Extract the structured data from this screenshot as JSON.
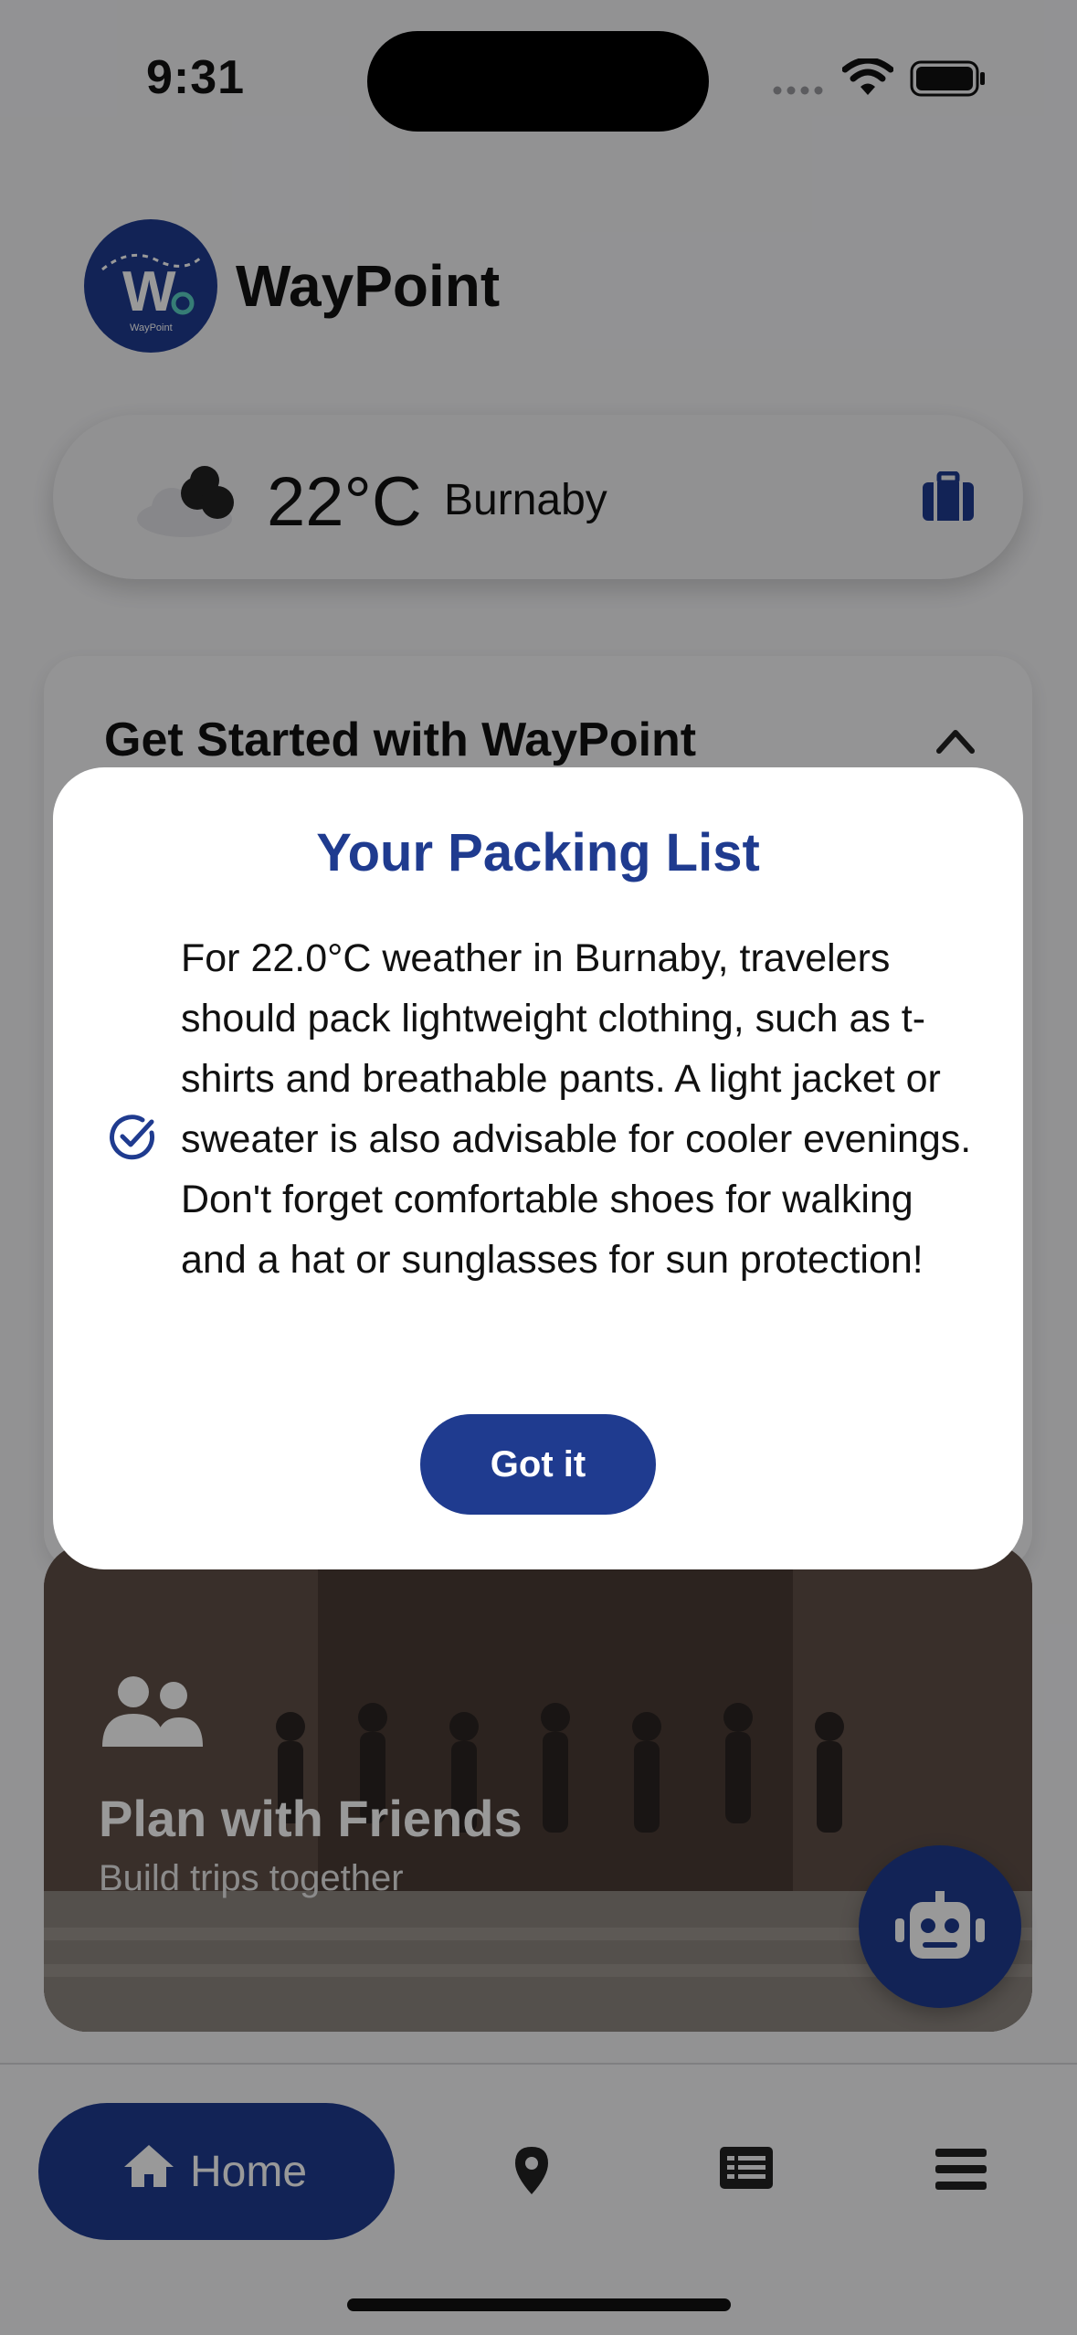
{
  "status_bar": {
    "time": "9:31"
  },
  "header": {
    "app_name": "WayPoint",
    "logo_letter": "W",
    "logo_caption": "WayPoint"
  },
  "weather": {
    "temperature": "22°C",
    "city": "Burnaby",
    "icon": "partly-cloudy-icon",
    "action_icon": "suitcase-icon"
  },
  "get_started": {
    "title": "Get Started with WayPoint",
    "toggle_icon": "chevron-up-icon"
  },
  "friends_card": {
    "title": "Plan with Friends",
    "subtitle": "Build trips together",
    "icon": "people-icon"
  },
  "assistant": {
    "icon": "robot-icon"
  },
  "modal": {
    "title": "Your Packing List",
    "body": "For 22.0°C weather in Burnaby, travelers should pack lightweight clothing, such as t-shirts and breathable pants. A light jacket or sweater is also advisable for cooler evenings. Don't forget comfortable shoes for walking and a hat or sunglasses for sun protection!",
    "button_label": "Got it",
    "icon": "check-circle-icon"
  },
  "bottom_nav": {
    "items": [
      {
        "label": "Home",
        "icon": "home-icon",
        "active": true
      },
      {
        "label": "",
        "icon": "map-pin-icon",
        "active": false
      },
      {
        "label": "",
        "icon": "list-icon",
        "active": false
      },
      {
        "label": "",
        "icon": "menu-icon",
        "active": false
      }
    ]
  },
  "colors": {
    "brand": "#1f3b8f",
    "background": "#f4f4f6",
    "scrim": "rgba(0,0,0,0.40)"
  }
}
